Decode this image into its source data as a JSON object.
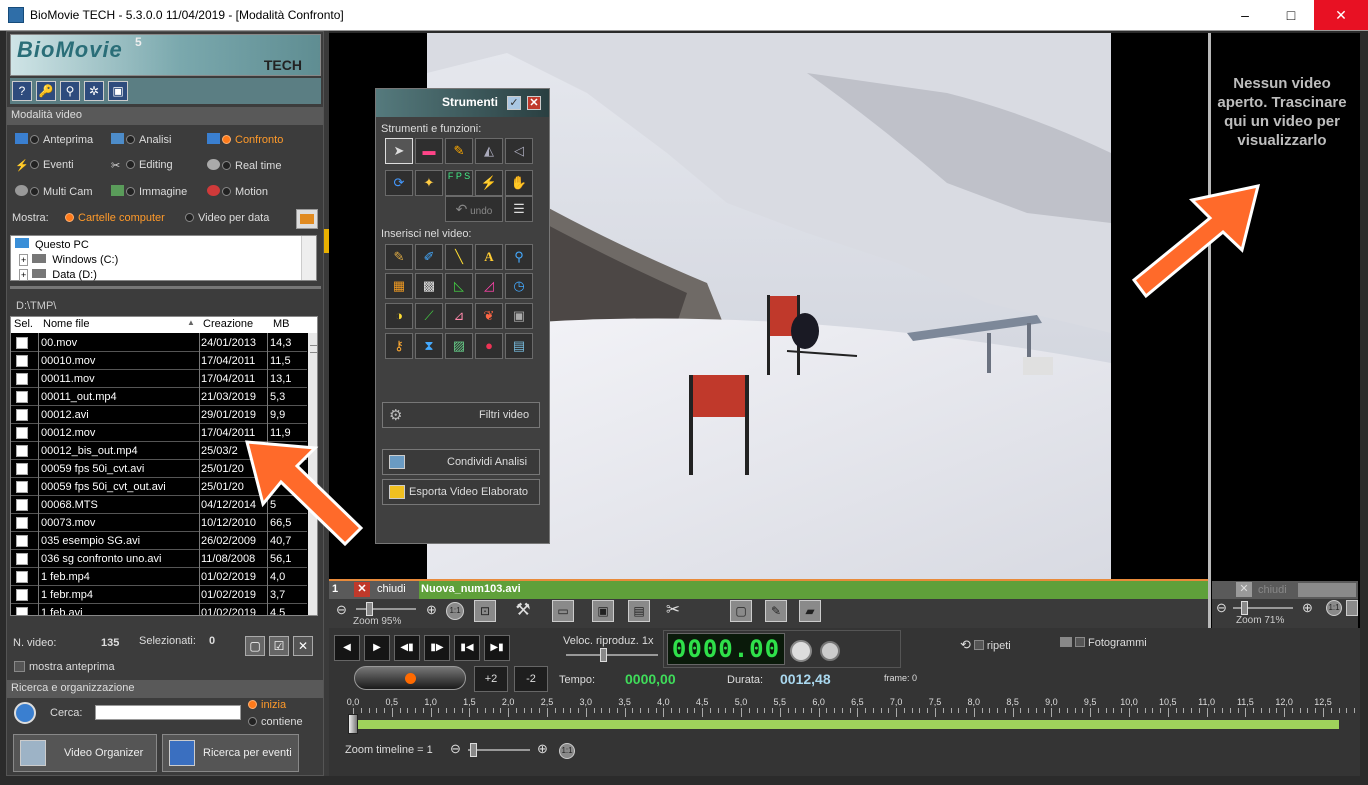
{
  "window": {
    "title": "BioMovie TECH - 5.3.0.0  11/04/2019 - [Modalità Confronto]",
    "minimize": "–",
    "maximize": "□",
    "close": "✕"
  },
  "logo": {
    "name": "BioMovie",
    "sup": "5",
    "sub": "TECH"
  },
  "iconbar": [
    "?",
    "🔑",
    "⚲",
    "✲",
    "▣"
  ],
  "modes": {
    "header": "Modalità video",
    "items": [
      {
        "label": "Anteprima",
        "selected": false
      },
      {
        "label": "Analisi",
        "selected": false
      },
      {
        "label": "Confronto",
        "selected": true
      },
      {
        "label": "Eventi",
        "selected": false
      },
      {
        "label": "Editing",
        "selected": false
      },
      {
        "label": "Real time",
        "selected": false
      },
      {
        "label": "Multi Cam",
        "selected": false
      },
      {
        "label": "Immagine",
        "selected": false
      },
      {
        "label": "Motion",
        "selected": false
      }
    ]
  },
  "show": {
    "label": "Mostra:",
    "opt1": "Cartelle computer",
    "opt2": "Video per data"
  },
  "tree": {
    "root": "Questo PC",
    "items": [
      "Windows (C:)",
      "Data (D:)"
    ],
    "expand": "+"
  },
  "path": "D:\\TMP\\",
  "files": {
    "headers": {
      "sel": "Sel.",
      "name": "Nome file",
      "date": "Creazione",
      "mb": "MB"
    },
    "rows": [
      {
        "name": "00.mov",
        "date": "24/01/2013",
        "mb": "14,3"
      },
      {
        "name": "00010.mov",
        "date": "17/04/2011",
        "mb": "11,5"
      },
      {
        "name": "00011.mov",
        "date": "17/04/2011",
        "mb": "13,1"
      },
      {
        "name": "00011_out.mp4",
        "date": "21/03/2019",
        "mb": "5,3"
      },
      {
        "name": "00012.avi",
        "date": "29/01/2019",
        "mb": "9,9"
      },
      {
        "name": "00012.mov",
        "date": "17/04/2011",
        "mb": "11,9"
      },
      {
        "name": "00012_bis_out.mp4",
        "date": "25/03/2",
        "mb": ""
      },
      {
        "name": "00059 fps 50i_cvt.avi",
        "date": "25/01/20",
        "mb": ""
      },
      {
        "name": "00059 fps 50i_cvt_out.avi",
        "date": "25/01/20",
        "mb": ""
      },
      {
        "name": "00068.MTS",
        "date": "04/12/2014",
        "mb": "5"
      },
      {
        "name": "00073.mov",
        "date": "10/12/2010",
        "mb": "66,5"
      },
      {
        "name": "035 esempio SG.avi",
        "date": "26/02/2009",
        "mb": "40,7"
      },
      {
        "name": "036 sg confronto uno.avi",
        "date": "11/08/2008",
        "mb": "56,1"
      },
      {
        "name": "1 feb.mp4",
        "date": "01/02/2019",
        "mb": "4,0"
      },
      {
        "name": "1 febr.mp4",
        "date": "01/02/2019",
        "mb": "3,7"
      },
      {
        "name": "1 feb.avi",
        "date": "01/02/2019",
        "mb": "4,5"
      }
    ]
  },
  "stats": {
    "nvideo_label": "N. video:",
    "nvideo": "135",
    "sel_label": "Selezionati:",
    "sel": "0",
    "preview": "mostra anteprima"
  },
  "search": {
    "header": "Ricerca e organizzazione",
    "label": "Cerca:",
    "value": "",
    "opt1": "inizia",
    "opt2": "contiene"
  },
  "buttons": {
    "organizer": "Video Organizer",
    "events": "Ricerca per eventi"
  },
  "no_video": "Nessun video aperto. Trascinare qui un video per visualizzarlo",
  "tools": {
    "title": "Strumenti",
    "sec1": "Strumenti e funzioni:",
    "undo": "undo",
    "fps": "F P S",
    "sec2": "Inserisci nel video:",
    "filters": "Filtri video",
    "share": "Condividi Analisi",
    "export": "Esporta Video Elaborato"
  },
  "player1": {
    "num": "1",
    "close": "chiudi",
    "file": "Nuova_num103.avi",
    "zoom": "Zoom 95%"
  },
  "player2": {
    "close": "chiudi",
    "zoom": "Zoom 71%"
  },
  "controls": {
    "speed_label": "Veloc. riproduz. 1x",
    "lcd": "0000.00",
    "repeat": "ripeti",
    "frames": "Fotogrammi",
    "plus": "+2",
    "minus": "-2",
    "time_label": "Tempo:",
    "time": "0000,00",
    "dur_label": "Durata:",
    "dur": "0012,48",
    "frame": "frame: 0",
    "zoomtl": "Zoom timeline = 1"
  },
  "ruler": [
    "0,0",
    "0,5",
    "1,0",
    "1,5",
    "2,0",
    "2,5",
    "3,0",
    "3,5",
    "4,0",
    "4,5",
    "5,0",
    "5,5",
    "6,0",
    "6,5",
    "7,0",
    "7,5",
    "8,0",
    "8,5",
    "9,0",
    "9,5",
    "10,0",
    "10,5",
    "11,0",
    "11,5",
    "12,0",
    "12,5"
  ]
}
